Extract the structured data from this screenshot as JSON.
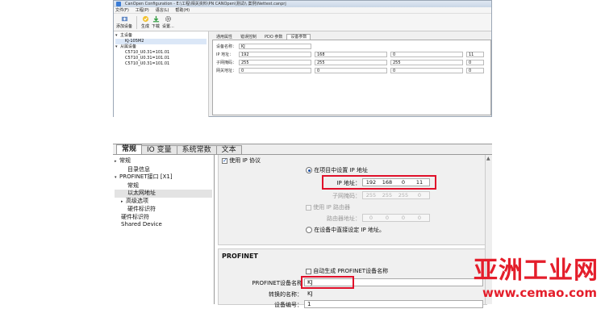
{
  "top": {
    "title": "CanOpen Configuration - E:\\工程\\相关资料\\PN CANOpen\\测试\\\\ 案例\\Nettest.canprj",
    "menu": [
      "文件(F)",
      "工程(P)",
      "语言(L)",
      "帮助(H)"
    ],
    "toolbar": {
      "add_device": "添加设备",
      "generate": "生成",
      "download": "下载",
      "settings": "设置..."
    },
    "tree": [
      {
        "label": "主设备",
        "level": 0,
        "arrow": "▾"
      },
      {
        "label": "KJ-105M2",
        "level": 1,
        "selected": true
      },
      {
        "label": "从属设备",
        "level": 0,
        "arrow": "▾"
      },
      {
        "label": "C5710_U0.31=101.01",
        "level": 1
      },
      {
        "label": "C5710_U0.31=101.01",
        "level": 1
      },
      {
        "label": "C5710_U0.31=101.01",
        "level": 1
      }
    ],
    "tabs": [
      "通用属性",
      "错误控制",
      "PDO 参数",
      "设备参数"
    ],
    "active_tab": 3,
    "form": {
      "name_label": "设备名称：",
      "name_value": "KJ",
      "rows": [
        {
          "label": "IP 地址：",
          "values": [
            "192",
            "168",
            "0",
            "11"
          ]
        },
        {
          "label": "子网掩码：",
          "values": [
            "255",
            "255",
            "255",
            "0"
          ]
        },
        {
          "label": "网关地址：",
          "values": [
            "0",
            "0",
            "0",
            "0"
          ]
        }
      ]
    }
  },
  "bottom": {
    "tabs": [
      "常规",
      "IO 变量",
      "系统常数",
      "文本"
    ],
    "active_tab": 0,
    "tree": [
      {
        "label": "常规",
        "indent": 0,
        "arrow": "▸"
      },
      {
        "label": "目录信息",
        "indent": 1
      },
      {
        "label": "PROFINET接口 [X1]",
        "indent": 0,
        "arrow": "▾"
      },
      {
        "label": "常规",
        "indent": 1
      },
      {
        "label": "以太网地址",
        "indent": 1,
        "selected": true
      },
      {
        "label": "高级选项",
        "indent": 1,
        "arrow": "▸"
      },
      {
        "label": "硬件标识符",
        "indent": 1
      },
      {
        "label": "硬件标识符",
        "indent": 0
      },
      {
        "label": "Shared Device",
        "indent": 0
      }
    ],
    "ip_protocol": {
      "use_ip_label": "使用 IP 协议",
      "set_in_project_label": "在项目中设置 IP 地址",
      "ip_label": "IP 地址：",
      "ip": [
        "192",
        "168",
        "0",
        "11"
      ],
      "subnet_label": "子网掩码：",
      "subnet": [
        "255",
        "255",
        "255",
        "0"
      ],
      "router_label": "使用 IP 路由器",
      "router_addr_label": "路由器地址：",
      "router": [
        "0",
        "0",
        "0",
        "0"
      ],
      "set_on_device_label": "在设备中直接设定 IP 地址。"
    },
    "profinet": {
      "heading": "PROFINET",
      "auto_gen_label": "自动生成 PROFINET设备名称",
      "device_name_label": "PROFINET设备名称",
      "device_name_value": "KJ",
      "converted_label": "转换的名称：",
      "converted_value": "KJ",
      "device_number_label": "设备编号：",
      "device_number_value": "1"
    }
  },
  "watermark": {
    "brand": "亚洲工业网",
    "url": "www.cemao.com"
  },
  "colors": {
    "highlight_red": "#e0102a",
    "watermark_red": "#e41e2b"
  }
}
